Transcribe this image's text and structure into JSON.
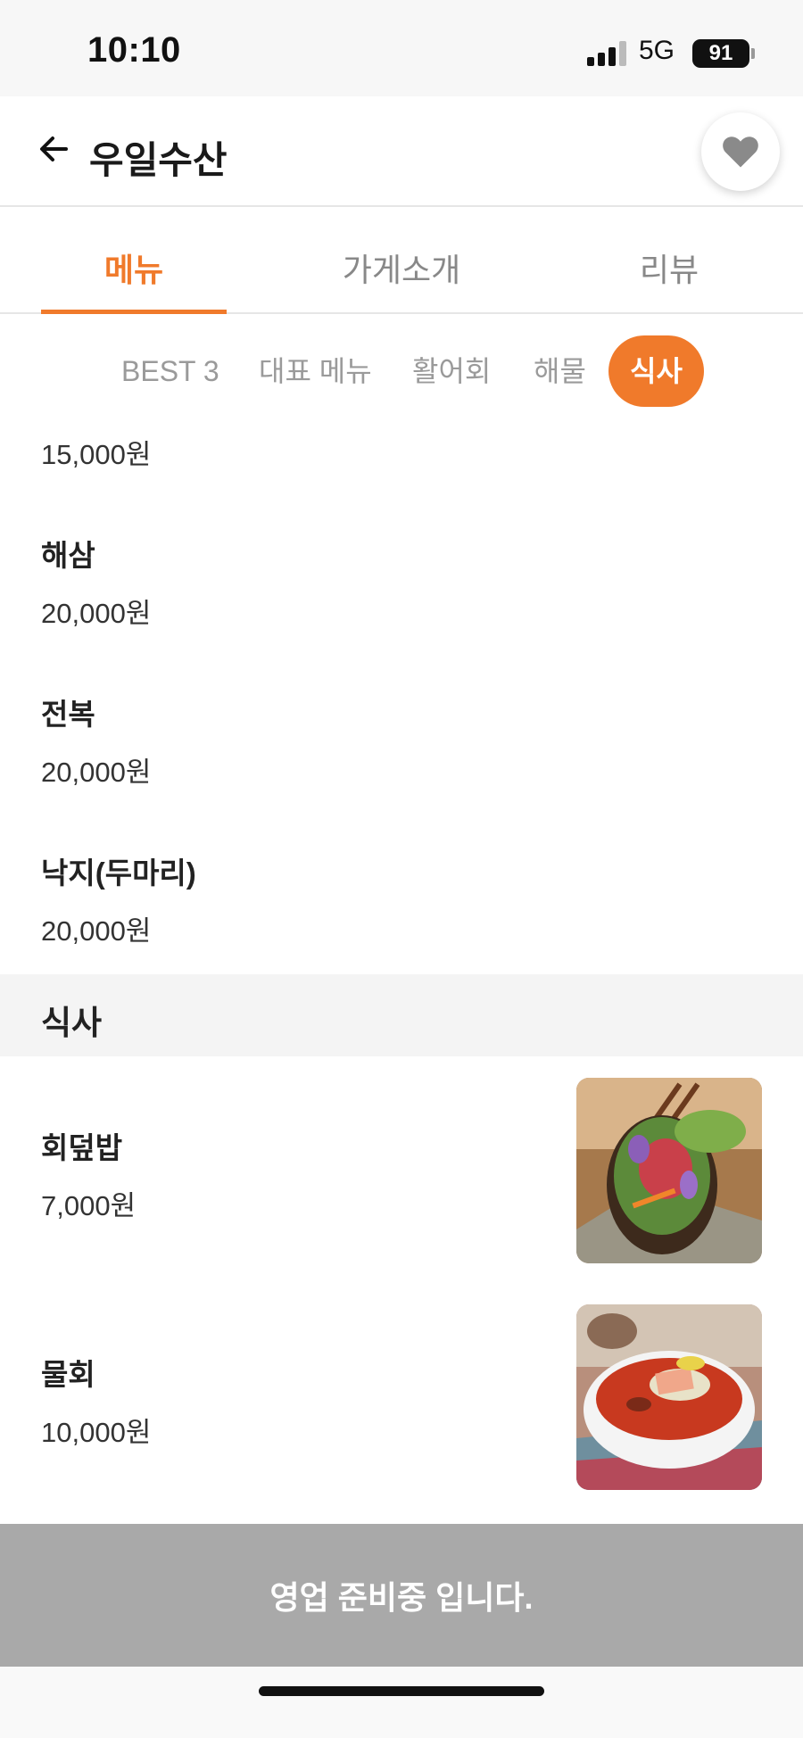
{
  "status_bar": {
    "time": "10:10",
    "network": "5G",
    "battery": "91"
  },
  "header": {
    "title": "우일수산"
  },
  "main_tabs": [
    {
      "label": "메뉴",
      "active": true
    },
    {
      "label": "가게소개",
      "active": false
    },
    {
      "label": "리뷰",
      "active": false
    }
  ],
  "categories": [
    {
      "label": "BEST 3",
      "active": false
    },
    {
      "label": "대표 메뉴",
      "active": false
    },
    {
      "label": "활어회",
      "active": false
    },
    {
      "label": "해물",
      "active": false
    },
    {
      "label": "식사",
      "active": true
    }
  ],
  "seafood_items": [
    {
      "price": "15,000원"
    },
    {
      "name": "해삼",
      "price": "20,000원"
    },
    {
      "name": "전복",
      "price": "20,000원"
    },
    {
      "name": "낙지(두마리)",
      "price": "20,000원"
    }
  ],
  "meal_section": {
    "title": "식사",
    "items": [
      {
        "name": "회덮밥",
        "price": "7,000원",
        "image": "hoedeopbap-photo"
      },
      {
        "name": "물회",
        "price": "10,000원",
        "image": "mulhoe-photo"
      }
    ]
  },
  "bottom_bar": {
    "text": "영업 준비중 입니다."
  },
  "colors": {
    "accent": "#f07a2b",
    "closed_bar": "#a9a9a9",
    "section_bg": "#f4f4f4"
  },
  "icons": [
    "back-arrow-icon",
    "heart-icon",
    "signal-icon",
    "battery-icon"
  ]
}
